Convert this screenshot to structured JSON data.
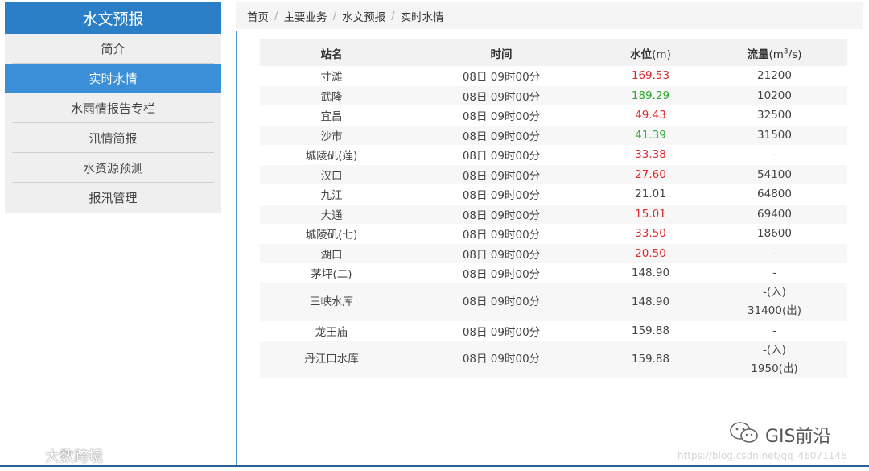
{
  "sidebar": {
    "title": "水文预报",
    "items": [
      {
        "label": "简介"
      },
      {
        "label": "实时水情"
      },
      {
        "label": "水雨情报告专栏"
      },
      {
        "label": "汛情简报"
      },
      {
        "label": "水资源预测"
      },
      {
        "label": "报汛管理"
      }
    ],
    "active_index": 1
  },
  "breadcrumb": [
    "首页",
    "主要业务",
    "水文预报",
    "实时水情"
  ],
  "table": {
    "headers": {
      "name": "站名",
      "time": "时间",
      "level": "水位",
      "level_unit": "(m)",
      "flow": "流量",
      "flow_unit_pre": "(m",
      "flow_unit_sup": "3",
      "flow_unit_post": "/s)"
    },
    "rows": [
      {
        "name": "寸滩",
        "time": "08日 09时00分",
        "level": "169.53",
        "flow": "21200",
        "level_color": "red"
      },
      {
        "name": "武隆",
        "time": "08日 09时00分",
        "level": "189.29",
        "flow": "10200",
        "level_color": "green"
      },
      {
        "name": "宜昌",
        "time": "08日 09时00分",
        "level": "49.43",
        "flow": "32500",
        "level_color": "red"
      },
      {
        "name": "沙市",
        "time": "08日 09时00分",
        "level": "41.39",
        "flow": "31500",
        "level_color": "green"
      },
      {
        "name": "城陵矶(莲)",
        "time": "08日 09时00分",
        "level": "33.38",
        "flow": "-",
        "level_color": "red"
      },
      {
        "name": "汉口",
        "time": "08日 09时00分",
        "level": "27.60",
        "flow": "54100",
        "level_color": "red"
      },
      {
        "name": "九江",
        "time": "08日 09时00分",
        "level": "21.01",
        "flow": "64800",
        "level_color": "normal"
      },
      {
        "name": "大通",
        "time": "08日 09时00分",
        "level": "15.01",
        "flow": "69400",
        "level_color": "red"
      },
      {
        "name": "城陵矶(七)",
        "time": "08日 09时00分",
        "level": "33.50",
        "flow": "18600",
        "level_color": "red"
      },
      {
        "name": "湖口",
        "time": "08日 09时00分",
        "level": "20.50",
        "flow": "-",
        "level_color": "red"
      },
      {
        "name": "茅坪(二)",
        "time": "08日 09时00分",
        "level": "148.90",
        "flow": "-",
        "level_color": "normal"
      },
      {
        "name": "三峡水库",
        "time": "08日 09时00分",
        "level": "148.90",
        "flow": "-(入)",
        "flow2": "31400(出)",
        "level_color": "normal"
      },
      {
        "name": "龙王庙",
        "time": "08日 09时00分",
        "level": "159.88",
        "flow": "-",
        "level_color": "normal"
      },
      {
        "name": "丹江口水库",
        "time": "08日 09时00分",
        "level": "159.88",
        "flow": "-(入)",
        "flow2": "1950(出)",
        "level_color": "normal"
      }
    ]
  },
  "watermarks": {
    "left": "大数跨境",
    "right": "GIS前沿",
    "url": "https://blog.csdn.net/qq_46071146"
  },
  "colors": {
    "accent": "#2b7fc6",
    "active": "#3a8fd8",
    "red": "#e0292a",
    "green": "#2ea82e",
    "border": "#5b9bd5"
  }
}
